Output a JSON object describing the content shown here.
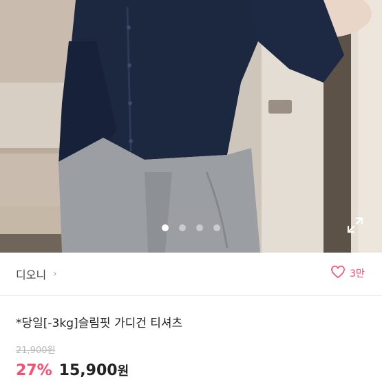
{
  "carousel": {
    "total_images": 4,
    "active_index": 0
  },
  "shop": {
    "name": "디오니",
    "chevron": "›",
    "likes": "3만"
  },
  "product": {
    "title": "*당일[-3kg]슬림핏 가디건 티셔츠",
    "original_price": "21,900원",
    "discount": "27%",
    "sale_price": "15,900",
    "currency": "원"
  },
  "colors": {
    "accent": "#ff4b6e",
    "text": "#222222",
    "muted": "#b9b9b9"
  },
  "icons": {
    "expand": "expand-icon",
    "like": "heart-icon",
    "chevron": "chevron-right-icon"
  }
}
